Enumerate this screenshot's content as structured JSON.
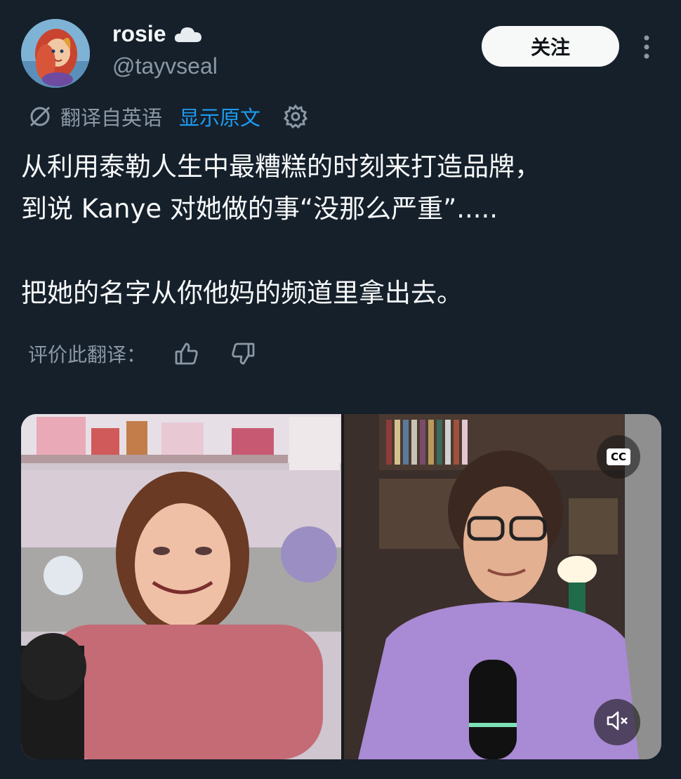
{
  "user": {
    "display_name": "rosie",
    "handle": "@tayvseal",
    "follow_label": "关注"
  },
  "translation": {
    "translated_from": "翻译自英语",
    "show_original": "显示原文"
  },
  "tweet": {
    "text": "从利用泰勒人生中最糟糕的时刻来打造品牌，\n到说 Kanye 对她做的事“没那么严重”.....\n\n把她的名字从你他妈的频道里拿出去。"
  },
  "rating": {
    "label": "评价此翻译："
  },
  "video": {
    "cc_label": "CC"
  },
  "icons": {
    "name_emoji": "cloud-icon",
    "more": "more-vertical-icon",
    "translate": "translate-icon",
    "settings": "gear-icon",
    "like": "thumbs-up-icon",
    "dislike": "thumbs-down-icon",
    "mute": "speaker-muted-icon"
  },
  "colors": {
    "background": "#15202b",
    "text_primary": "#f7f9f9",
    "text_secondary": "#8b98a5",
    "link": "#1d9bf0",
    "follow_button_bg": "#f7f9f9"
  }
}
